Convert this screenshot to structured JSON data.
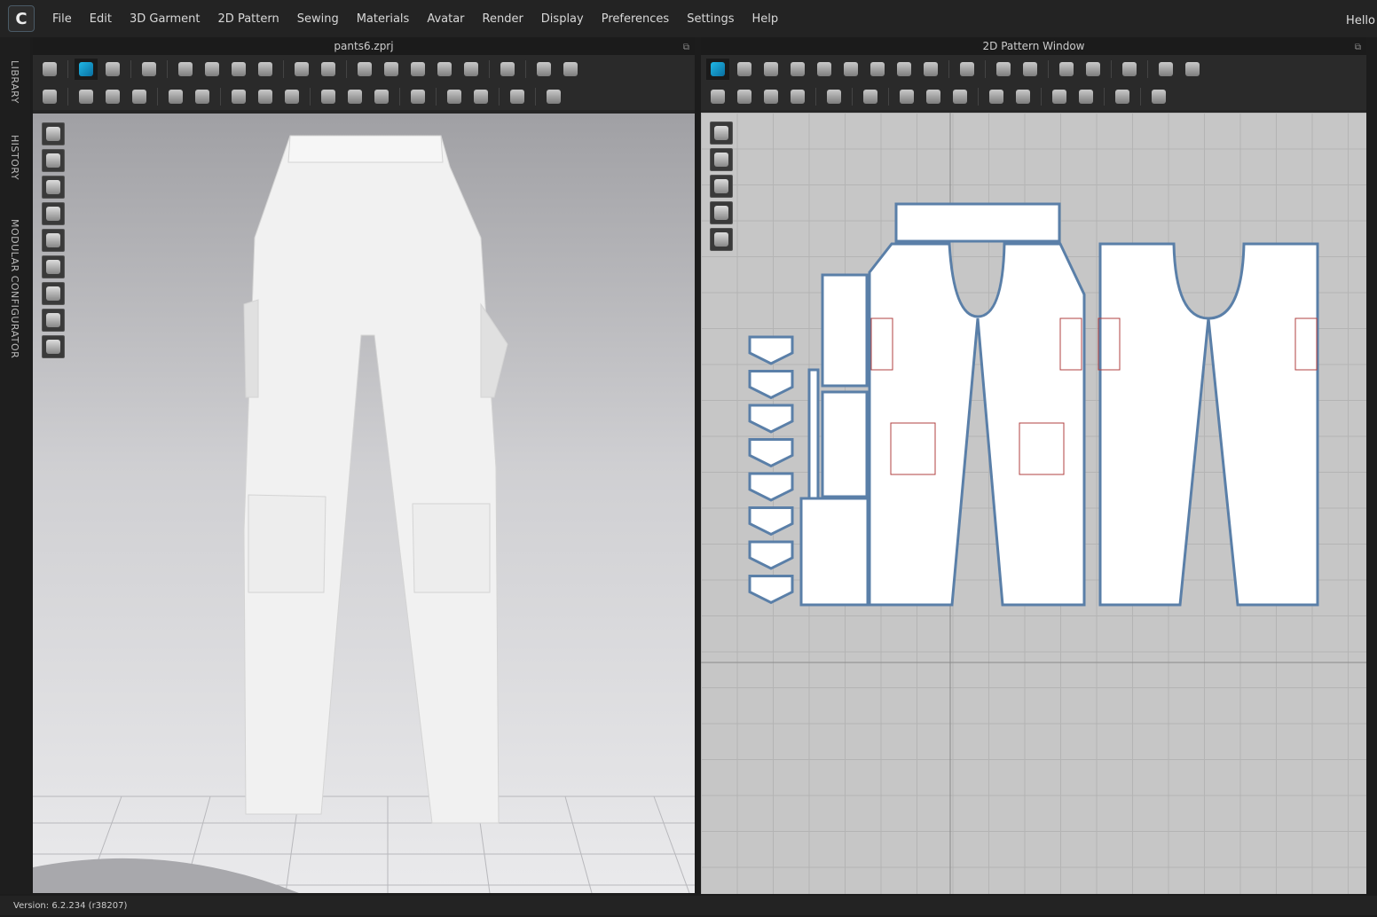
{
  "app": {
    "logo": "C",
    "greeting": "Hello"
  },
  "menu": [
    "File",
    "Edit",
    "3D Garment",
    "2D Pattern",
    "Sewing",
    "Materials",
    "Avatar",
    "Render",
    "Display",
    "Preferences",
    "Settings",
    "Help"
  ],
  "side_tabs": [
    "LIBRARY",
    "HISTORY",
    "MODULAR CONFIGURATOR"
  ],
  "panel3d": {
    "title": "pants6.zprj",
    "row1": [
      "drop-arrow-icon",
      "|",
      "select-move-icon",
      "transform-pattern-icon",
      "|",
      "simulation-shirt-icon",
      "|",
      "segment-sewing-icon",
      "free-sewing-icon",
      "free-curve-sewing-icon",
      "tack-icon",
      "|",
      "pin-icon",
      "steam-icon",
      "|",
      "fold-icon",
      "show-garment-icon",
      "shirt-icon",
      "jacket-icon",
      "avatar-icon",
      "|",
      "measure-icon",
      "|",
      "more-icon",
      "more-icon"
    ],
    "row2": [
      "avatar-walk-icon",
      "|",
      "edit-curve-point-icon",
      "edit-curvature-icon",
      "brush-icon",
      "|",
      "segment-icon",
      "curve-icon",
      "|",
      "zipper-icon",
      "graphic-icon",
      "texture-icon",
      "|",
      "button-icon",
      "buttonhole-icon",
      "lock-button-icon",
      "|",
      "zipper-pull-icon",
      "|",
      "select-trim-icon",
      "fabric-roll-icon",
      "|",
      "trim-icon",
      "|",
      "more-icon"
    ],
    "view_icons": [
      "avatar-box-icon",
      "garment-icon",
      "show-garment-icon",
      "show-texture-icon",
      "show-avatar-icon",
      "show-fabric-icon",
      "render-icon",
      "avatar-head-icon",
      "globe-icon"
    ]
  },
  "panel2d": {
    "title": "2D Pattern Window",
    "row1": [
      "edit-pattern-icon",
      "polygon-icon",
      "rectangle-icon",
      "circle-icon",
      "internal-polygon-icon",
      "dart-icon",
      "trace-icon",
      "cut-icon",
      "pattern-outline-icon",
      "|",
      "fold-arrange-icon",
      "|",
      "seam-allowance-icon",
      "ruler-icon",
      "|",
      "text-select-icon",
      "text-icon",
      "|",
      "grading-icon",
      "|",
      "texture-edit-icon",
      "avatar-pose-icon"
    ],
    "row2": [
      "segment-sewing-icon",
      "free-sewing-icon",
      "curve-sewing-icon",
      "sewing-check-icon",
      "|",
      "iron-icon",
      "|",
      "puckering-icon",
      "|",
      "graphic-icon",
      "texture-icon",
      "trim-icon",
      "|",
      "topstitch-icon",
      "dashed-line-icon",
      "|",
      "elastic-icon",
      "zigzag-icon",
      "|",
      "fold-add-icon",
      "|",
      "gift-icon"
    ],
    "view_icons": [
      "pattern-line-icon",
      "show-garment-icon",
      "info-icon",
      "show-fabric-icon",
      "lock-garment-icon"
    ]
  },
  "status": {
    "version": "Version: 6.2.234 (r38207)"
  }
}
